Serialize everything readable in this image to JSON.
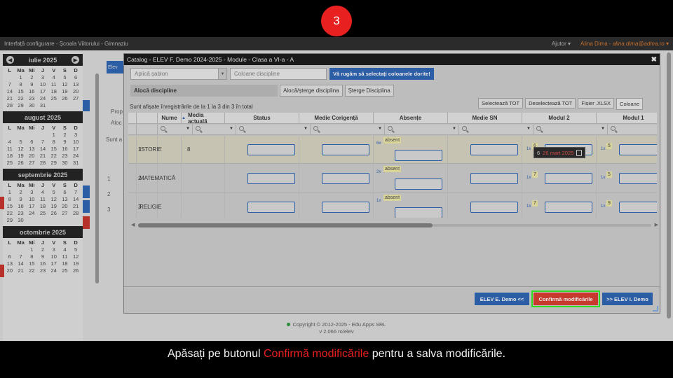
{
  "step": "3",
  "topbar": {
    "title": "Interfață configurare - Școala Viitorului - Gimnaziu",
    "help": "Ajutor",
    "user_name": "Alina Dima",
    "user_email": "alina.dima@adma.ro"
  },
  "calendar": {
    "weekdays": [
      "L",
      "Ma",
      "Mi",
      "J",
      "V",
      "S",
      "D"
    ],
    "months": [
      {
        "title": "iulie 2025",
        "offset": 1,
        "days": 31,
        "visible": 31
      },
      {
        "title": "august 2025",
        "offset": 4,
        "days": 31,
        "visible": 31
      },
      {
        "title": "septembrie 2025",
        "offset": 0,
        "days": 30,
        "visible": 30
      },
      {
        "title": "octombrie 2025",
        "offset": 2,
        "days": 31,
        "visible": 26
      }
    ]
  },
  "background": {
    "btn_label": "Elev",
    "tab1": "Prop",
    "tab2": "Aloc",
    "header": "Sunt a",
    "rows": [
      "1",
      "2",
      "3"
    ]
  },
  "dialog": {
    "title": "Catalog - ELEV F. Demo 2024-2025 - Module - Clasa a VI-a - A",
    "close": "✖",
    "template_placeholder": "Aplică șablon",
    "columns_placeholder": "Coloane discipline",
    "notice": "Vă rugăm să selectați coloanele dorite!",
    "tab_label": "Alocă discipline",
    "btn_allocate": "Alocă/șterge disciplina",
    "btn_delete": "Șterge Disciplina",
    "info": "Sunt afișate înregistrările de la 1 la 3 din 3 în total",
    "btn_select_all": "Selectează TOT",
    "btn_deselect_all": "Deselectează TOT",
    "btn_xlsx": "Fișier .XLSX",
    "btn_columns": "Coloane",
    "headers": [
      "Nume",
      "Media actuală",
      "Status",
      "Medie Corigență",
      "Absențe",
      "Medie SN",
      "Modul 2",
      "Modul 1"
    ],
    "rows": [
      {
        "nr": "1",
        "name": "ISTORIE",
        "media": "8",
        "abs_count": "6x",
        "abs_label": "absent",
        "m2_count": "1x",
        "m2_grade": "6",
        "m1_count": "1x",
        "m1_grade": "5"
      },
      {
        "nr": "2",
        "name": "MATEMATICĂ",
        "media": "",
        "abs_count": "2x",
        "abs_label": "absent",
        "m2_count": "1x",
        "m2_grade": "7",
        "m1_count": "1x",
        "m1_grade": "5"
      },
      {
        "nr": "3",
        "name": "RELIGIE",
        "media": "",
        "abs_count": "1x",
        "abs_label": "absent",
        "m2_count": "1x",
        "m2_grade": "7",
        "m1_count": "1x",
        "m1_grade": "9"
      }
    ],
    "tooltip": {
      "grade": "6",
      "date": "26 mart 2025"
    },
    "footer": {
      "prev": "ELEV E. Demo <<",
      "confirm": "Confirmă modificările",
      "next": ">> ELEV I. Demo"
    }
  },
  "copyright": {
    "line1": "Copyright © 2012-2025 - Edu Apps SRL",
    "line2": "v 2.066 ro/elev"
  },
  "caption": {
    "before": "Apăsați pe butonul ",
    "highlight": "Confirmă modificările",
    "after": " pentru a salva modificările."
  }
}
